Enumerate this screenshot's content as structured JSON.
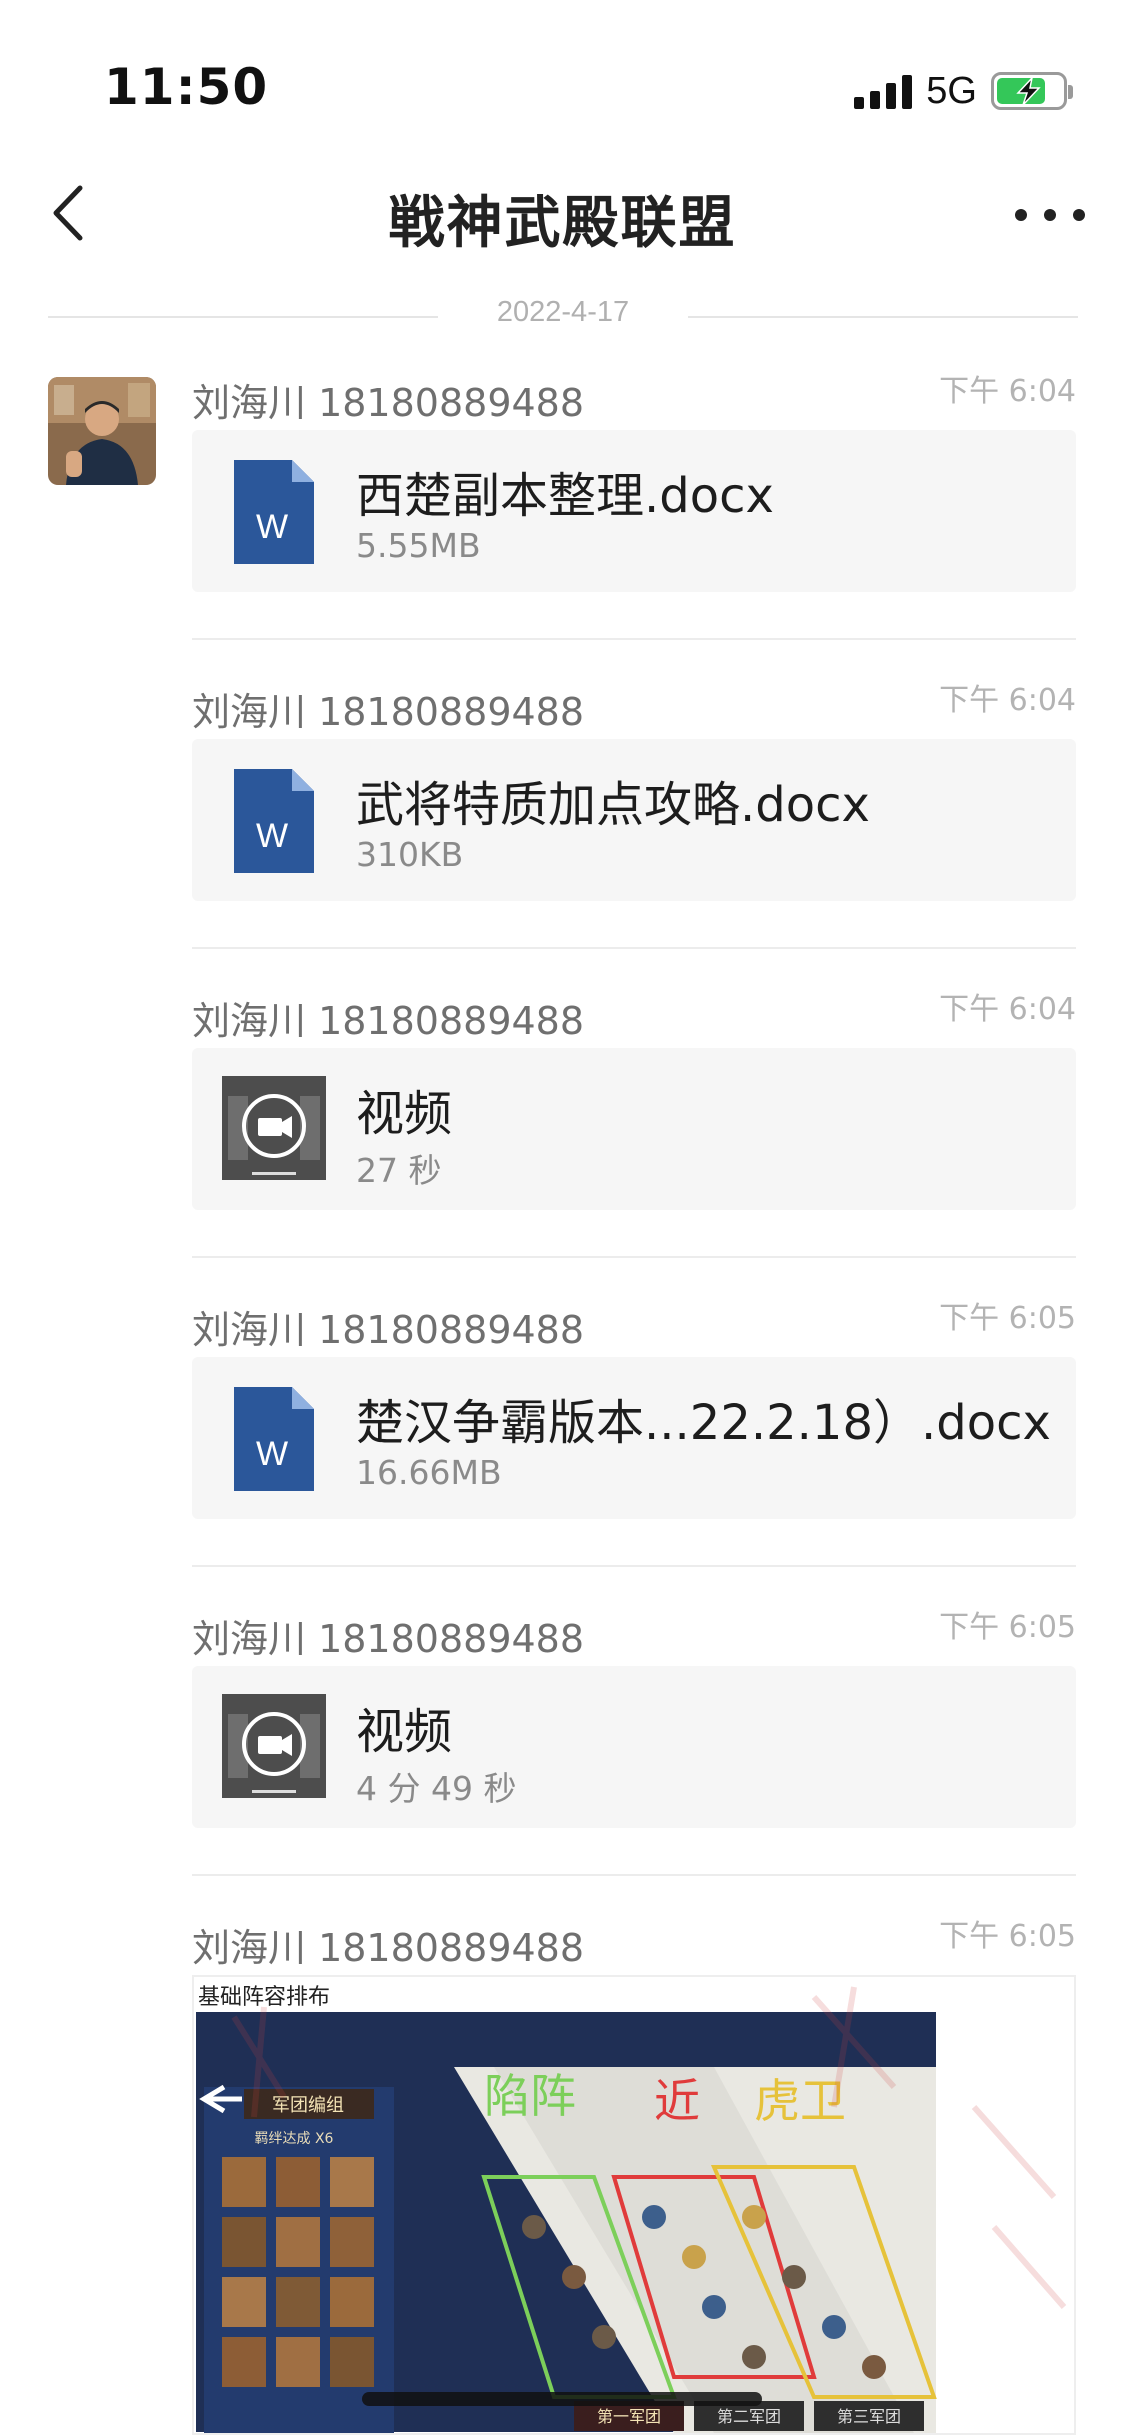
{
  "status_bar": {
    "time": "11:50",
    "network": "5G",
    "battery_level": 0.75,
    "battery_color": "#34c759"
  },
  "header": {
    "title": "戦神武殿联盟"
  },
  "date_divider": "2022-4-17",
  "messages": [
    {
      "sender": "刘海川 18180889488",
      "time": "下午 6:04",
      "type": "file",
      "icon": "word-doc-icon",
      "name": "西楚副本整理.docx",
      "meta": "5.55MB"
    },
    {
      "sender": "刘海川 18180889488",
      "time": "下午 6:04",
      "type": "file",
      "icon": "word-doc-icon",
      "name": "武将特质加点攻略.docx",
      "meta": "310KB"
    },
    {
      "sender": "刘海川 18180889488",
      "time": "下午 6:04",
      "type": "video",
      "icon": "video-play-icon",
      "name": "视频",
      "meta": "27 秒"
    },
    {
      "sender": "刘海川 18180889488",
      "time": "下午 6:05",
      "type": "file",
      "icon": "word-doc-icon",
      "name": "楚汉争霸版本...22.2.18）.docx",
      "meta": "16.66MB"
    },
    {
      "sender": "刘海川 18180889488",
      "time": "下午 6:05",
      "type": "video",
      "icon": "video-play-icon",
      "name": "视频",
      "meta": "4 分 49 秒"
    },
    {
      "sender": "刘海川 18180889488",
      "time": "下午 6:05",
      "type": "image",
      "image": {
        "caption": "基础阵容排布",
        "game_title": "军团编组",
        "game_subtitle": "羁绊达成 X6",
        "handwritten": [
          "陷阵",
          "近",
          "虎卫"
        ],
        "tabs": [
          "第一军团",
          "第二军团",
          "第三军团"
        ]
      }
    }
  ],
  "colors": {
    "word_blue": "#2b579a",
    "accent_green": "#34c759"
  }
}
